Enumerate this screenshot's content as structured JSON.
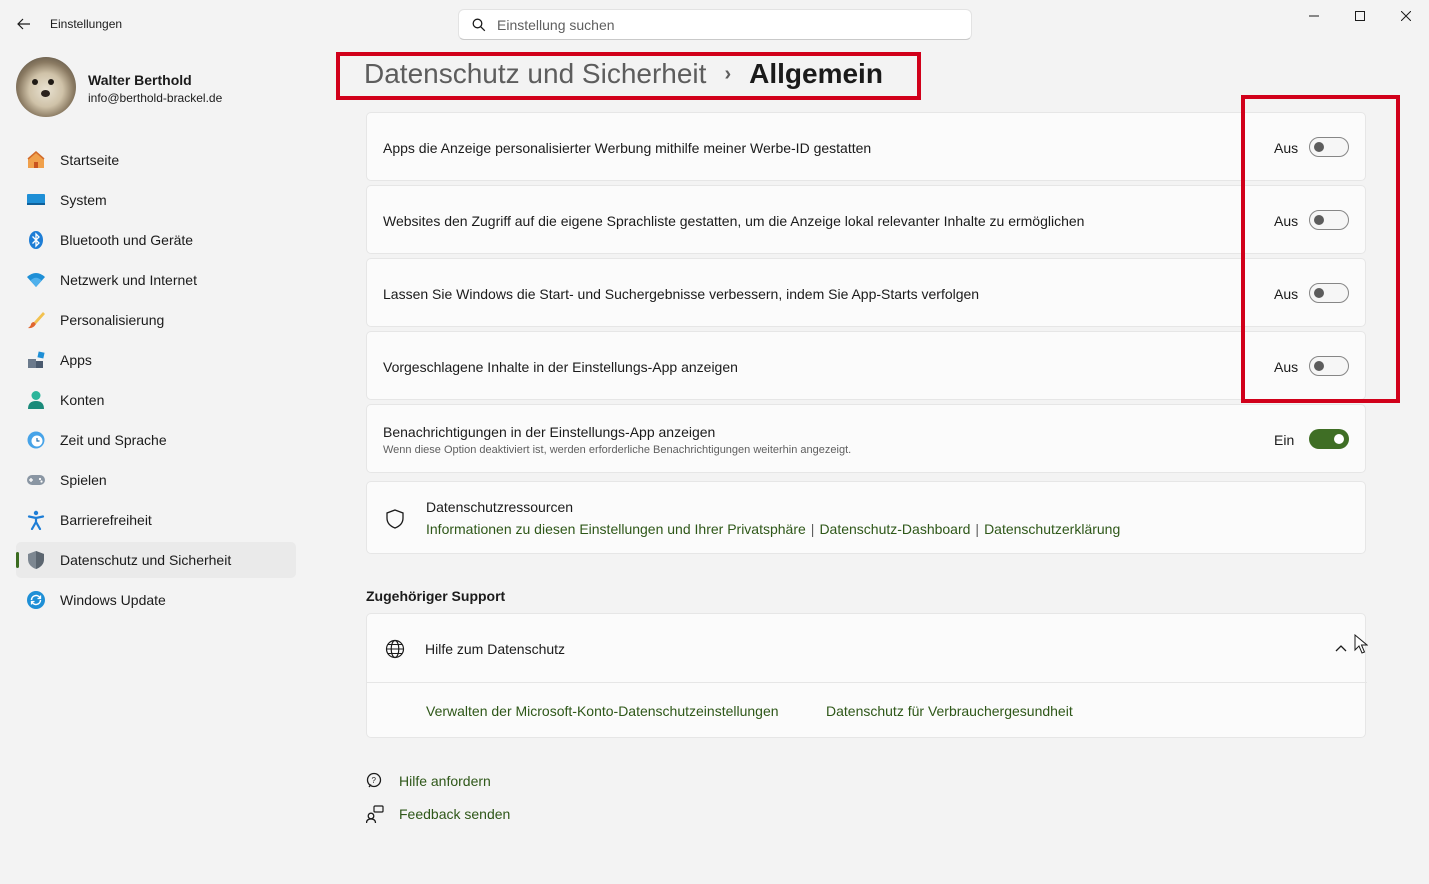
{
  "window": {
    "app_title": "Einstellungen",
    "search_placeholder": "Einstellung suchen"
  },
  "user": {
    "name": "Walter Berthold",
    "email": "info@berthold-brackel.de"
  },
  "sidebar": {
    "items": [
      {
        "label": "Startseite",
        "icon": "home-icon"
      },
      {
        "label": "System",
        "icon": "monitor-icon"
      },
      {
        "label": "Bluetooth und Geräte",
        "icon": "bluetooth-icon"
      },
      {
        "label": "Netzwerk und Internet",
        "icon": "wifi-icon"
      },
      {
        "label": "Personalisierung",
        "icon": "brush-icon"
      },
      {
        "label": "Apps",
        "icon": "apps-icon"
      },
      {
        "label": "Konten",
        "icon": "person-icon"
      },
      {
        "label": "Zeit und Sprache",
        "icon": "clock-globe-icon"
      },
      {
        "label": "Spielen",
        "icon": "gamepad-icon"
      },
      {
        "label": "Barrierefreiheit",
        "icon": "accessibility-icon"
      },
      {
        "label": "Datenschutz und Sicherheit",
        "icon": "shield-icon",
        "active": true
      },
      {
        "label": "Windows Update",
        "icon": "update-icon"
      }
    ]
  },
  "header": {
    "parent": "Datenschutz und Sicherheit",
    "separator": "›",
    "current": "Allgemein"
  },
  "settings": [
    {
      "label": "Apps die Anzeige personalisierter Werbung mithilfe meiner Werbe-ID gestatten",
      "state": "Aus",
      "on": false
    },
    {
      "label": "Websites den Zugriff auf die eigene Sprachliste gestatten, um die Anzeige lokal relevanter Inhalte zu ermöglichen",
      "state": "Aus",
      "on": false
    },
    {
      "label": "Lassen Sie Windows die Start- und Suchergebnisse verbessern, indem Sie App-Starts verfolgen",
      "state": "Aus",
      "on": false
    },
    {
      "label": "Vorgeschlagene Inhalte in der Einstellungs-App anzeigen",
      "state": "Aus",
      "on": false
    },
    {
      "label": "Benachrichtigungen in der Einstellungs-App anzeigen",
      "sublabel": "Wenn diese Option deaktiviert ist, werden erforderliche Benachrichtigungen weiterhin angezeigt.",
      "state": "Ein",
      "on": true
    }
  ],
  "resources": {
    "title": "Datenschutzressourcen",
    "links": [
      "Informationen zu diesen Einstellungen und Ihrer Privatsphäre",
      "Datenschutz-Dashboard",
      "Datenschutzerklärung"
    ],
    "separator": "|"
  },
  "support": {
    "section_title": "Zugehöriger Support",
    "help_title": "Hilfe zum Datenschutz",
    "links": [
      "Verwalten der Microsoft-Konto-Datenschutzeinstellungen",
      "Datenschutz für Verbrauchergesundheit"
    ]
  },
  "footer": {
    "get_help": "Hilfe anfordern",
    "feedback": "Feedback senden"
  },
  "colors": {
    "accent": "#3f6e25",
    "link": "#2e5718",
    "highlight": "#d1001a"
  }
}
